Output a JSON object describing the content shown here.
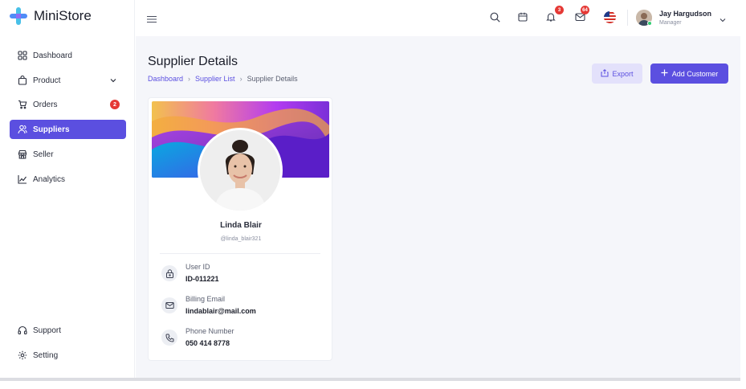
{
  "brand": {
    "name": "MiniStore"
  },
  "sidebar": {
    "items": [
      {
        "label": "Dashboard",
        "icon": "grid-icon"
      },
      {
        "label": "Product",
        "icon": "bag-icon",
        "expandable": true
      },
      {
        "label": "Orders",
        "icon": "cart-icon",
        "badge": "2"
      },
      {
        "label": "Suppliers",
        "icon": "users-icon",
        "active": true
      },
      {
        "label": "Seller",
        "icon": "store-icon"
      },
      {
        "label": "Analytics",
        "icon": "chart-icon"
      }
    ],
    "bottom_items": [
      {
        "label": "Support",
        "icon": "headset-icon"
      },
      {
        "label": "Setting",
        "icon": "gear-icon"
      }
    ]
  },
  "topbar": {
    "notifications_badge": "3",
    "messages_badge": "64",
    "user": {
      "name": "Jay Hargudson",
      "role": "Manager"
    }
  },
  "page": {
    "title": "Supplier Details",
    "breadcrumb": [
      "Dashboard",
      "Supplier List",
      "Supplier Details"
    ],
    "export_label": "Export",
    "add_label": "Add Customer"
  },
  "supplier": {
    "name": "Linda Blair",
    "handle": "@linda_blair321",
    "fields": [
      {
        "label": "User ID",
        "value": "ID-011221",
        "icon": "lock-icon"
      },
      {
        "label": "Billing Email",
        "value": "lindablair@mail.com",
        "icon": "mail-icon"
      },
      {
        "label": "Phone Number",
        "value": "050 414 8778",
        "icon": "phone-icon"
      }
    ]
  },
  "colors": {
    "accent": "#5b4fe0",
    "badge": "#e53935",
    "background": "#f5f6fa"
  }
}
